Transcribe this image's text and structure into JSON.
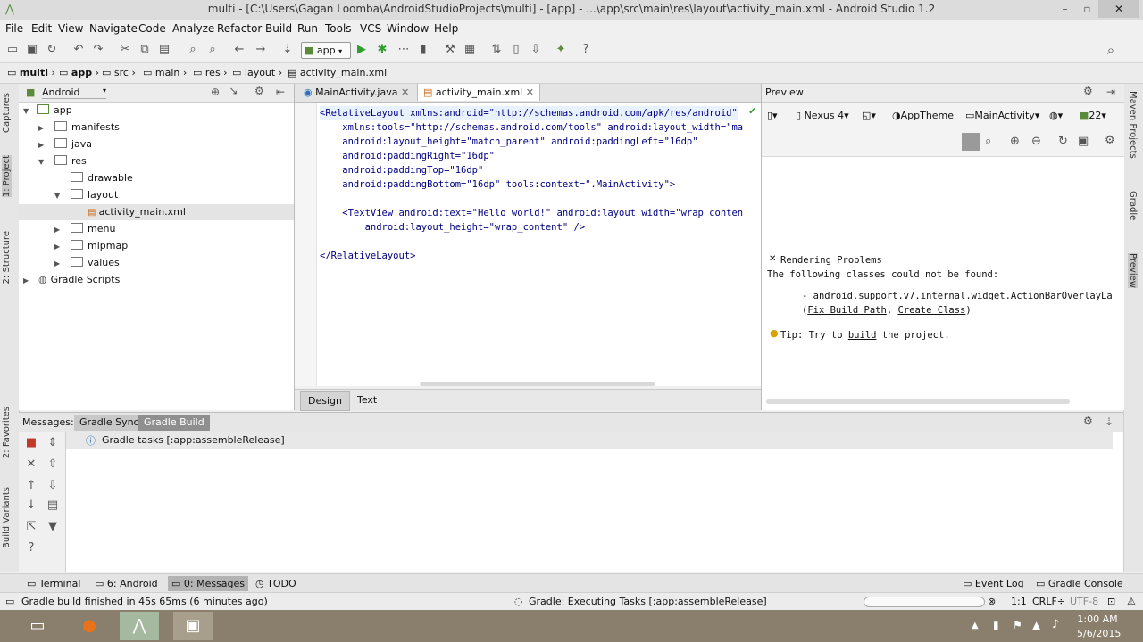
{
  "window": {
    "title": "multi - [C:\\Users\\Gagan Loomba\\AndroidStudioProjects\\multi] - [app] - ...\\app\\src\\main\\res\\layout\\activity_main.xml - Android Studio 1.2"
  },
  "menu": [
    "File",
    "Edit",
    "View",
    "Navigate",
    "Code",
    "Analyze",
    "Refactor",
    "Build",
    "Run",
    "Tools",
    "VCS",
    "Window",
    "Help"
  ],
  "toolbar": {
    "run_config": "app"
  },
  "breadcrumb": [
    "multi",
    "app",
    "src",
    "main",
    "res",
    "layout",
    "activity_main.xml"
  ],
  "left_strip": [
    "1: Project",
    "2: Structure",
    "Captures",
    "2: Favorites",
    "Build Variants"
  ],
  "right_strip": [
    "Maven Projects",
    "Gradle",
    "Preview"
  ],
  "project": {
    "view_selector": "Android",
    "tree": [
      {
        "label": "app",
        "type": "module"
      },
      {
        "label": "manifests",
        "type": "folder"
      },
      {
        "label": "java",
        "type": "folder"
      },
      {
        "label": "res",
        "type": "folder"
      },
      {
        "label": "drawable",
        "type": "folder"
      },
      {
        "label": "layout",
        "type": "folder"
      },
      {
        "label": "activity_main.xml",
        "type": "file"
      },
      {
        "label": "menu",
        "type": "folder"
      },
      {
        "label": "mipmap",
        "type": "folder"
      },
      {
        "label": "values",
        "type": "folder"
      },
      {
        "label": "Gradle Scripts",
        "type": "gradle"
      }
    ]
  },
  "editor": {
    "tabs": [
      "MainActivity.java",
      "activity_main.xml"
    ],
    "code": [
      "<RelativeLayout xmlns:android=\"http://schemas.android.com/apk/res/android\"",
      "    xmlns:tools=\"http://schemas.android.com/tools\" android:layout_width=\"ma",
      "    android:layout_height=\"match_parent\" android:paddingLeft=\"16dp\"",
      "    android:paddingRight=\"16dp\"",
      "    android:paddingTop=\"16dp\"",
      "    android:paddingBottom=\"16dp\" tools:context=\".MainActivity\">",
      "",
      "    <TextView android:text=\"Hello world!\" android:layout_width=\"wrap_conten",
      "        android:layout_height=\"wrap_content\" />",
      "",
      "</RelativeLayout>"
    ],
    "mode_tabs": [
      "Design",
      "Text"
    ]
  },
  "preview": {
    "title": "Preview",
    "device": "Nexus 4",
    "theme": "AppTheme",
    "activity": "MainActivity",
    "api": "22",
    "rendering_title": "Rendering Problems",
    "line1": "The following classes could not be found:",
    "class_missing": "- android.support.v7.internal.widget.ActionBarOverlayLa",
    "fix_build_path": "Fix Build Path",
    "create_class": "Create Class",
    "tip_prefix": "Tip: Try to ",
    "tip_link": "build",
    "tip_suffix": " the project."
  },
  "messages": {
    "label": "Messages:",
    "tabs": [
      "Gradle Sync",
      "Gradle Build"
    ],
    "row": "Gradle tasks [:app:assembleRelease]"
  },
  "bottom_tabs": {
    "left": [
      "Terminal",
      "6: Android",
      "0: Messages",
      "TODO"
    ],
    "right": [
      "Event Log",
      "Gradle Console"
    ]
  },
  "status": {
    "left": "Gradle build finished in 45s 65ms (6 minutes ago)",
    "center": "Gradle: Executing Tasks [:app:assembleRelease]",
    "position": "1:1",
    "line_sep": "CRLF",
    "encoding": "UTF-8"
  },
  "taskbar": {
    "time": "1:00 AM",
    "date": "5/6/2015"
  }
}
